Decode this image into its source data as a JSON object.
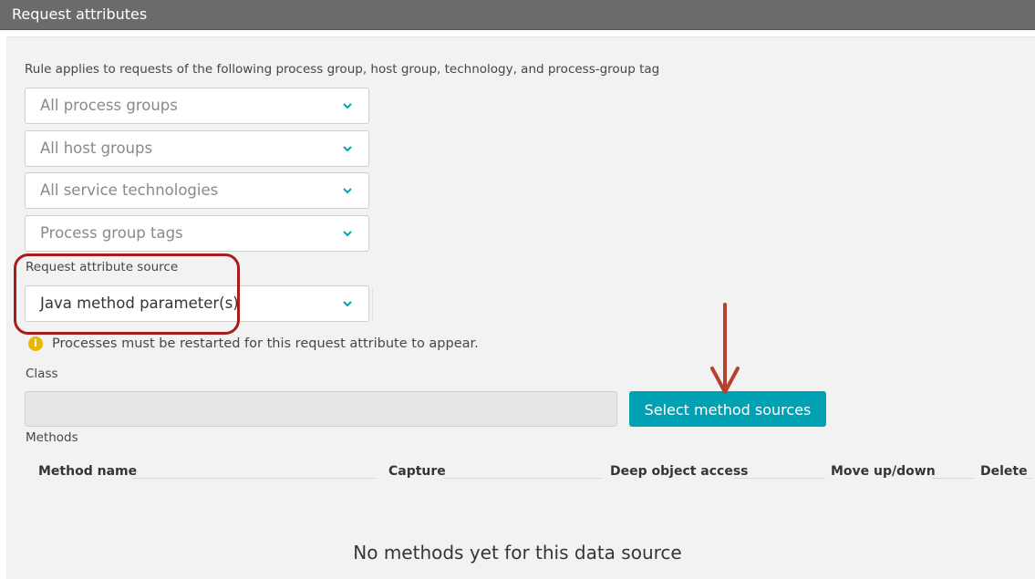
{
  "titlebar": {
    "title": "Request attributes"
  },
  "rule": {
    "description": "Rule applies to requests of the following process group, host group, technology, and process-group tag",
    "selects": [
      {
        "value": "All process groups"
      },
      {
        "value": "All host groups"
      },
      {
        "value": "All service technologies"
      },
      {
        "value": "Process group tags"
      }
    ]
  },
  "source": {
    "label": "Request attribute source",
    "value": "Java method parameter(s)"
  },
  "notice": {
    "text": "Processes must be restarted for this request attribute to appear."
  },
  "class_field": {
    "label": "Class",
    "value": ""
  },
  "actions": {
    "select_sources": "Select method sources"
  },
  "methods": {
    "label": "Methods",
    "columns": [
      "Method name",
      "Capture",
      "Deep object access",
      "Move up/down",
      "Delete"
    ],
    "empty_message": "No methods yet for this data source"
  },
  "colors": {
    "titlebar": "#6b6b6b",
    "accent": "#00a1b2",
    "highlight": "#a61d1d",
    "arrow": "#b3412e",
    "warning": "#e9b800"
  }
}
